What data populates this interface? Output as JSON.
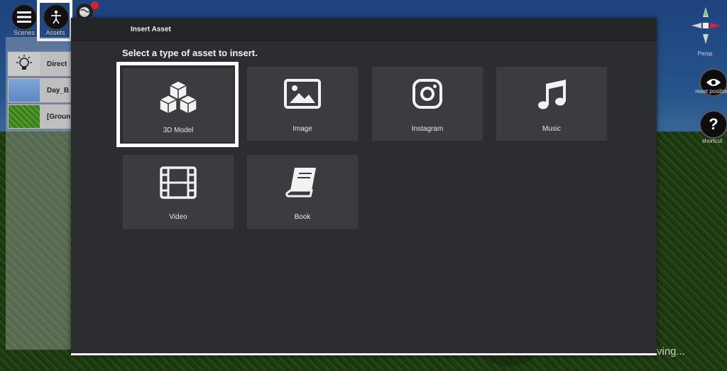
{
  "toolbar": {
    "menu_label": "Scenes",
    "assets_label": "Assets"
  },
  "scene_list": {
    "items": [
      {
        "label": "Direct"
      },
      {
        "label": "Day_B"
      },
      {
        "label": "[Groun"
      }
    ]
  },
  "modal": {
    "title": "Insert Asset",
    "subtitle": "Select a type of asset to insert.",
    "assets": [
      {
        "label": "3D Model",
        "icon": "cubes-icon"
      },
      {
        "label": "Image",
        "icon": "image-icon"
      },
      {
        "label": "Instagram",
        "icon": "instagram-icon"
      },
      {
        "label": "Music",
        "icon": "music-icon"
      },
      {
        "label": "Video",
        "icon": "film-icon"
      },
      {
        "label": "Book",
        "icon": "book-icon"
      }
    ]
  },
  "right_panel": {
    "view_label": "Persp",
    "reset_label": "reset position",
    "shortcut_label": "shortcut"
  },
  "status": {
    "saving_text": "ving..."
  },
  "colors": {
    "modal_bg": "#2b2d30",
    "tile_bg": "#3a3c3f",
    "highlight": "#ffffff"
  }
}
